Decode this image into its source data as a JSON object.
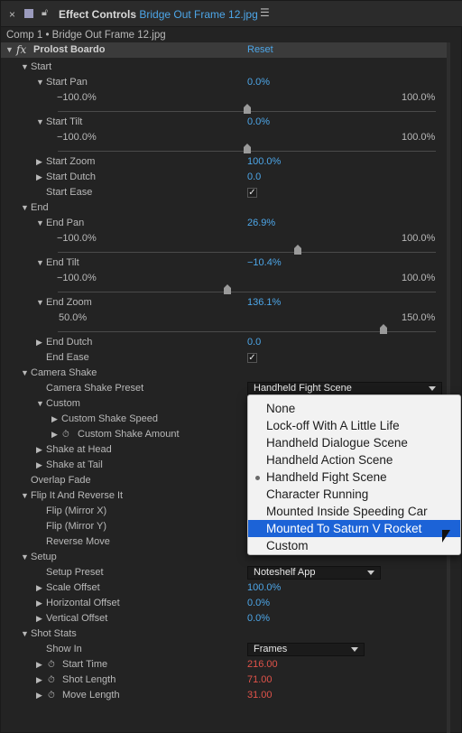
{
  "tab": {
    "title": "Effect Controls",
    "file": "Bridge Out Frame 12.jpg"
  },
  "breadcrumb": "Comp 1 • Bridge Out Frame 12.jpg",
  "effect": {
    "name": "Prolost Boardo",
    "reset": "Reset"
  },
  "start": {
    "label": "Start",
    "pan": {
      "label": "Start Pan",
      "value": "0.0%",
      "min": "−100.0%",
      "max": "100.0%",
      "fraction": 0.5
    },
    "tilt": {
      "label": "Start Tilt",
      "value": "0.0%",
      "min": "−100.0%",
      "max": "100.0%",
      "fraction": 0.5
    },
    "zoom": {
      "label": "Start Zoom",
      "value": "100.0%"
    },
    "dutch": {
      "label": "Start Dutch",
      "value": "0.0"
    },
    "ease": {
      "label": "Start Ease",
      "checked": "✓"
    }
  },
  "end": {
    "label": "End",
    "pan": {
      "label": "End Pan",
      "value": "26.9%",
      "min": "−100.0%",
      "max": "100.0%",
      "fraction": 0.6345
    },
    "tilt": {
      "label": "End Tilt",
      "value": "−10.4%",
      "min": "−100.0%",
      "max": "100.0%",
      "fraction": 0.448
    },
    "zoom": {
      "label": "End Zoom",
      "value": "136.1%",
      "min": "50.0%",
      "max": "150.0%",
      "fraction": 0.861
    },
    "dutch": {
      "label": "End Dutch",
      "value": "0.0"
    },
    "ease": {
      "label": "End Ease",
      "checked": "✓"
    }
  },
  "camera_shake": {
    "label": "Camera Shake",
    "preset_label": "Camera Shake Preset",
    "preset_value": "Handheld Fight Scene",
    "custom": "Custom",
    "custom_speed": "Custom Shake Speed",
    "custom_amount": "Custom Shake Amount",
    "shake_head": "Shake at Head",
    "shake_tail": "Shake at Tail"
  },
  "overlap_fade": "Overlap Fade",
  "flip": {
    "label": "Flip It And Reverse It",
    "flip_x": "Flip (Mirror X)",
    "flip_y": "Flip (Mirror Y)",
    "reverse": "Reverse Move"
  },
  "setup": {
    "label": "Setup",
    "preset_label": "Setup Preset",
    "preset_value": "Noteshelf App",
    "scale_offset": {
      "label": "Scale Offset",
      "value": "100.0%"
    },
    "h_offset": {
      "label": "Horizontal Offset",
      "value": "0.0%"
    },
    "v_offset": {
      "label": "Vertical Offset",
      "value": "0.0%"
    }
  },
  "shot_stats": {
    "label": "Shot Stats",
    "show_in_label": "Show In",
    "show_in_value": "Frames",
    "start_time": {
      "label": "Start Time",
      "value": "216.00"
    },
    "shot_length": {
      "label": "Shot Length",
      "value": "71.00"
    },
    "move_length": {
      "label": "Move Length",
      "value": "31.00"
    }
  },
  "popup": {
    "items": [
      "None",
      "Lock-off With A Little Life",
      "Handheld Dialogue Scene",
      "Handheld Action Scene",
      "Handheld Fight Scene",
      "Character Running",
      "Mounted Inside Speeding Car",
      "Mounted To Saturn V Rocket",
      "Custom"
    ],
    "checked_index": 4,
    "highlighted_index": 7
  },
  "colors": {
    "accent": "#4da6e8",
    "timing": "#e0534a",
    "highlight": "#1c63d7"
  }
}
